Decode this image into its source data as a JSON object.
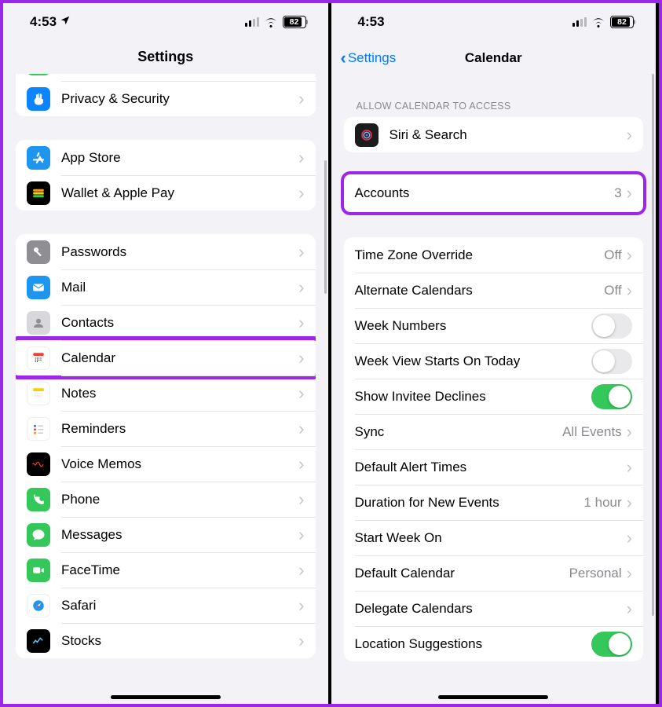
{
  "status": {
    "time": "4:53",
    "battery": "82"
  },
  "left": {
    "title": "Settings",
    "rows": {
      "privacy": "Privacy & Security",
      "appstore": "App Store",
      "wallet": "Wallet & Apple Pay",
      "passwords": "Passwords",
      "mail": "Mail",
      "contacts": "Contacts",
      "calendar": "Calendar",
      "notes": "Notes",
      "reminders": "Reminders",
      "voicememos": "Voice Memos",
      "phone": "Phone",
      "messages": "Messages",
      "facetime": "FaceTime",
      "safari": "Safari",
      "stocks": "Stocks"
    }
  },
  "right": {
    "back": "Settings",
    "title": "Calendar",
    "section1": "ALLOW CALENDAR TO ACCESS",
    "siri": "Siri & Search",
    "accounts": {
      "label": "Accounts",
      "value": "3"
    },
    "tz": {
      "label": "Time Zone Override",
      "value": "Off"
    },
    "alt": {
      "label": "Alternate Calendars",
      "value": "Off"
    },
    "weeknum": "Week Numbers",
    "weekview": "Week View Starts On Today",
    "invitee": "Show Invitee Declines",
    "sync": {
      "label": "Sync",
      "value": "All Events"
    },
    "alerts": "Default Alert Times",
    "duration": {
      "label": "Duration for New Events",
      "value": "1 hour"
    },
    "startweek": "Start Week On",
    "defcal": {
      "label": "Default Calendar",
      "value": "Personal"
    },
    "delegate": "Delegate Calendars",
    "locsug": "Location Suggestions"
  }
}
